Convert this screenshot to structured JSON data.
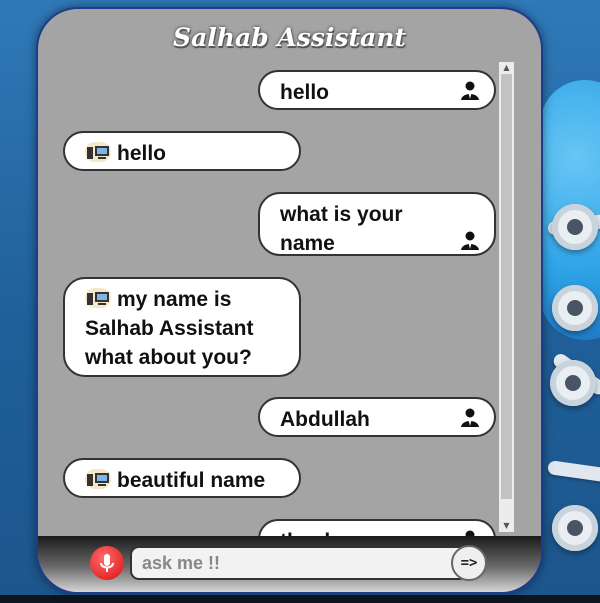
{
  "app": {
    "title": "Salhab Assistant"
  },
  "messages": [
    {
      "sender": "user",
      "text": "hello",
      "icon": "user-icon"
    },
    {
      "sender": "bot",
      "text": "hello",
      "icon": "computer-icon"
    },
    {
      "sender": "user",
      "text": "what is your name",
      "icon": "user-icon"
    },
    {
      "sender": "bot",
      "text": "my name is Salhab Assistant what about you?",
      "icon": "computer-icon"
    },
    {
      "sender": "user",
      "text": "Abdullah",
      "icon": "user-icon"
    },
    {
      "sender": "bot",
      "text": "beautiful name",
      "icon": "computer-icon"
    },
    {
      "sender": "user",
      "text": "thanks",
      "icon": "user-icon"
    }
  ],
  "composer": {
    "placeholder": "ask me !!",
    "send_label": "=>",
    "mic_icon": "microphone-icon"
  },
  "colors": {
    "panel": "#a4a4a4",
    "bubble": "#ffffff",
    "border": "#1d3c8d",
    "mic": "#e52b2b"
  }
}
